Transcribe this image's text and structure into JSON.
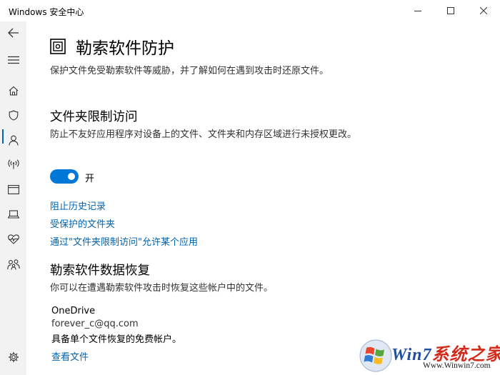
{
  "window": {
    "title": "Windows 安全中心"
  },
  "sidebar": {
    "items": [
      {
        "icon": "back-arrow-icon"
      },
      {
        "icon": "hamburger-menu-icon"
      },
      {
        "icon": "home-icon"
      },
      {
        "icon": "shield-icon"
      },
      {
        "icon": "person-icon"
      },
      {
        "icon": "wireless-antenna-icon"
      },
      {
        "icon": "browser-window-icon"
      },
      {
        "icon": "laptop-icon"
      },
      {
        "icon": "heart-health-icon"
      },
      {
        "icon": "family-icon"
      },
      {
        "icon": "gear-icon"
      }
    ]
  },
  "page": {
    "title": "勒索软件防护",
    "description": "保护文件免受勒索软件等威胁，并了解如何在遇到攻击时还原文件。"
  },
  "cfa": {
    "title": "文件夹限制访问",
    "description": "防止不友好应用程序对设备上的文件、文件夹和内存区域进行未授权更改。",
    "toggle_on": true,
    "toggle_label": "开",
    "links": [
      "阻止历史记录",
      "受保护的文件夹",
      "通过\"文件夹限制访问\"允许某个应用"
    ]
  },
  "recovery": {
    "title": "勒索软件数据恢复",
    "description": "你可以在遭遇勒索软件攻击时恢复这些帐户中的文件。",
    "provider": "OneDrive",
    "account": "forever_c@qq.com",
    "account_type": "具备单个文件恢复的免费帐户。",
    "view_files_link": "查看文件"
  },
  "watermark": {
    "brand_part1": "Win7",
    "brand_part2": "系统之家",
    "url": "Www.Winwin7.com"
  },
  "colors": {
    "accent": "#0078d7",
    "link": "#0063b1",
    "sidebar_bg": "#f2f2f2"
  }
}
